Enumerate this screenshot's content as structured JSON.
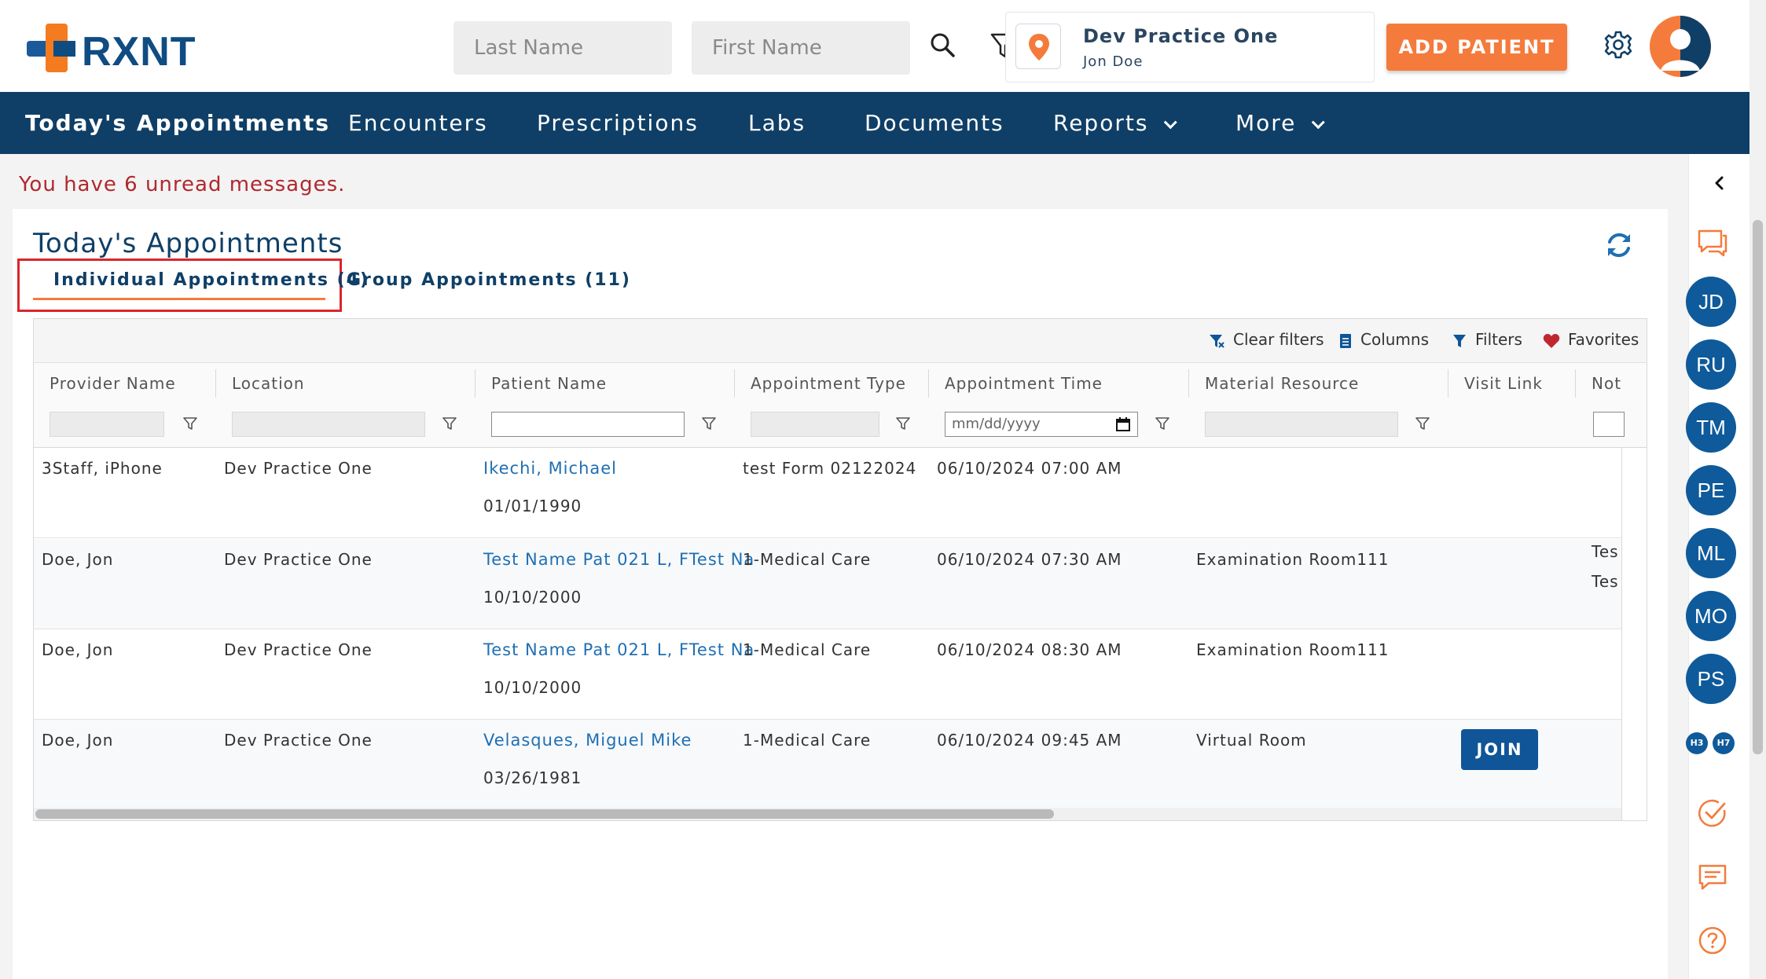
{
  "header": {
    "logo_text": "RXNT",
    "last_name_placeholder": "Last Name",
    "first_name_placeholder": "First Name",
    "practice_name": "Dev Practice One",
    "practice_user": "Jon Doe",
    "add_patient_label": "ADD PATIENT"
  },
  "nav": {
    "items": [
      {
        "label": "Today's Appointments"
      },
      {
        "label": "Encounters"
      },
      {
        "label": "Prescriptions"
      },
      {
        "label": "Labs"
      },
      {
        "label": "Documents"
      },
      {
        "label": "Reports"
      },
      {
        "label": "More"
      }
    ]
  },
  "messages": {
    "unread_text": "You have 6 unread messages."
  },
  "page": {
    "title": "Today's Appointments",
    "tabs": [
      {
        "label": "Individual Appointments (4)"
      },
      {
        "label": "Group Appointments (11)"
      }
    ]
  },
  "grid": {
    "toolbar": {
      "clear_filters": "Clear filters",
      "columns": "Columns",
      "filters": "Filters",
      "favorites": "Favorites"
    },
    "columns": [
      "Provider Name",
      "Location",
      "Patient Name",
      "Appointment Type",
      "Appointment Time",
      "Material Resource",
      "Visit Link",
      "Not"
    ],
    "date_placeholder": "mm/dd/yyyy",
    "rows": [
      {
        "provider": "3Staff, iPhone",
        "location": "Dev Practice One",
        "patient": "Ikechi, Michael",
        "dob": "01/01/1990",
        "type": "test Form 02122024",
        "time": "06/10/2024 07:00 AM",
        "resource": "",
        "note1": "",
        "note2": ""
      },
      {
        "provider": "Doe, Jon",
        "location": "Dev Practice One",
        "patient": "Test Name Pat 021 L, FTest Na",
        "dob": "10/10/2000",
        "type": "1-Medical Care",
        "time": "06/10/2024 07:30 AM",
        "resource": "Examination Room111",
        "note1": "Tes",
        "note2": "Tes"
      },
      {
        "provider": "Doe, Jon",
        "location": "Dev Practice One",
        "patient": "Test Name Pat 021 L, FTest Na",
        "dob": "10/10/2000",
        "type": "1-Medical Care",
        "time": "06/10/2024 08:30 AM",
        "resource": "Examination Room111",
        "note1": "",
        "note2": ""
      },
      {
        "provider": "Doe, Jon",
        "location": "Dev Practice One",
        "patient": "Velasques, Miguel Mike",
        "dob": "03/26/1981",
        "type": "1-Medical Care",
        "time": "06/10/2024 09:45 AM",
        "resource": "Virtual Room",
        "note1": "",
        "note2": ""
      }
    ],
    "join_label": "JOIN"
  },
  "sidebar": {
    "avatars": [
      "JD",
      "RU",
      "TM",
      "PE",
      "ML",
      "MO",
      "PS"
    ],
    "mini": [
      "H3",
      "H7"
    ]
  },
  "colors": {
    "brand_navy": "#0f3f66",
    "brand_orange": "#f47b3c",
    "alert_red": "#b0292e",
    "link_blue": "#1f6fb3"
  }
}
